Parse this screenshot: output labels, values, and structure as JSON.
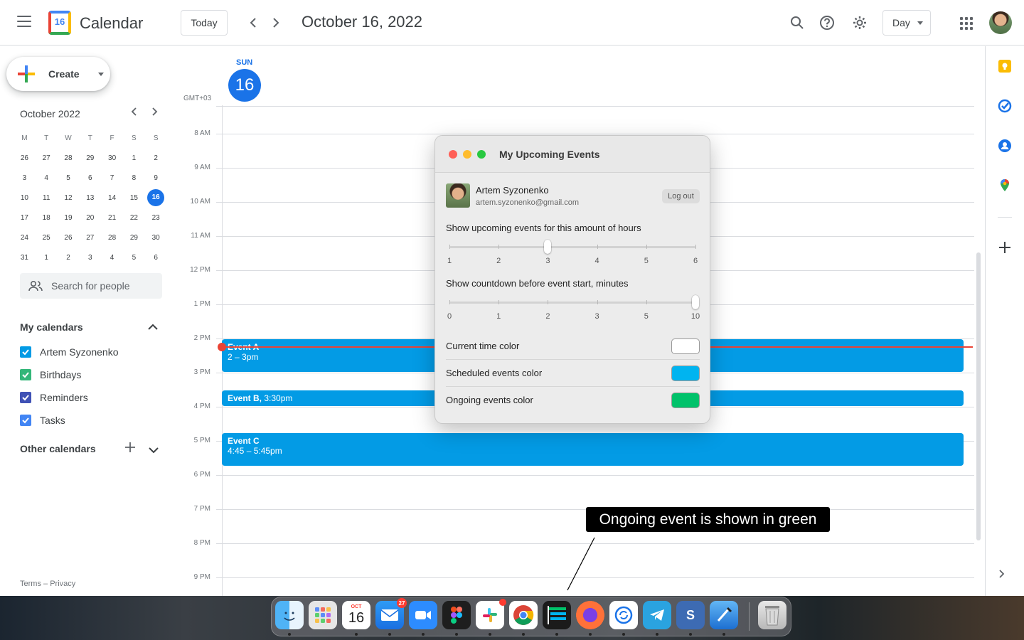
{
  "header": {
    "app_title": "Calendar",
    "logo_day": "16",
    "today_label": "Today",
    "prev_label": "‹",
    "next_label": "›",
    "date_title": "October 16, 2022",
    "view_label": "Day"
  },
  "sidebar": {
    "create_label": "Create",
    "mini_calendar": {
      "title": "October 2022",
      "weekdays": [
        "M",
        "T",
        "W",
        "T",
        "F",
        "S",
        "S"
      ],
      "weeks": [
        [
          "26",
          "27",
          "28",
          "29",
          "30",
          "1",
          "2"
        ],
        [
          "3",
          "4",
          "5",
          "6",
          "7",
          "8",
          "9"
        ],
        [
          "10",
          "11",
          "12",
          "13",
          "14",
          "15",
          "16"
        ],
        [
          "17",
          "18",
          "19",
          "20",
          "21",
          "22",
          "23"
        ],
        [
          "24",
          "25",
          "26",
          "27",
          "28",
          "29",
          "30"
        ],
        [
          "31",
          "1",
          "2",
          "3",
          "4",
          "5",
          "6"
        ]
      ],
      "today": "16"
    },
    "search_placeholder": "Search for people",
    "my_calendars_title": "My calendars",
    "my_calendars": [
      {
        "label": "Artem Syzonenko",
        "color": "#039be5"
      },
      {
        "label": "Birthdays",
        "color": "#33b679"
      },
      {
        "label": "Reminders",
        "color": "#3f51b5"
      },
      {
        "label": "Tasks",
        "color": "#4285f4"
      }
    ],
    "other_calendars_title": "Other calendars",
    "footer_terms": "Terms",
    "footer_sep": "–",
    "footer_privacy": "Privacy"
  },
  "day_view": {
    "day_name": "SUN",
    "day_number": "16",
    "timezone": "GMT+03",
    "hours": [
      "8 AM",
      "9 AM",
      "10 AM",
      "11 AM",
      "12 PM",
      "1 PM",
      "2 PM",
      "3 PM",
      "4 PM",
      "5 PM",
      "6 PM",
      "7 PM",
      "8 PM",
      "9 PM"
    ],
    "events": [
      {
        "name": "Event A",
        "time": "2 – 3pm"
      },
      {
        "name": "Event B,",
        "time": "3:30pm"
      },
      {
        "name": "Event C",
        "time": "4:45 – 5:45pm"
      }
    ],
    "event_color": "#039be5",
    "now_color": "#ea4335"
  },
  "popup": {
    "title": "My Upcoming Events",
    "user_name": "Artem Syzonenko",
    "user_email": "artem.syzonenko@gmail.com",
    "logout_label": "Log out",
    "hours_label": "Show upcoming events for this amount of hours",
    "hours_ticks": [
      "1",
      "2",
      "3",
      "4",
      "5",
      "6"
    ],
    "hours_value": "3",
    "countdown_label": "Show countdown before event start, minutes",
    "countdown_ticks": [
      "0",
      "1",
      "2",
      "3",
      "5",
      "10"
    ],
    "countdown_value": "10",
    "colors": [
      {
        "label": "Current time color",
        "value": "#ffffff"
      },
      {
        "label": "Scheduled events color",
        "value": "#00b4f0"
      },
      {
        "label": "Ongoing events color",
        "value": "#00c26a"
      }
    ]
  },
  "annotation": {
    "text": "Ongoing event is shown in green"
  },
  "dock": {
    "mail_badge": "27",
    "calendar_month": "OCT",
    "calendar_day": "16",
    "apps": [
      "finder-icon",
      "launchpad-icon",
      "calendar-icon",
      "mail-icon",
      "zoom-icon",
      "figma-icon",
      "slack-icon",
      "chrome-icon",
      "upcoming-events-icon",
      "firefox-icon",
      "sync-icon",
      "telegram-icon",
      "scrivener-icon",
      "xcode-icon",
      "trash-icon"
    ]
  }
}
